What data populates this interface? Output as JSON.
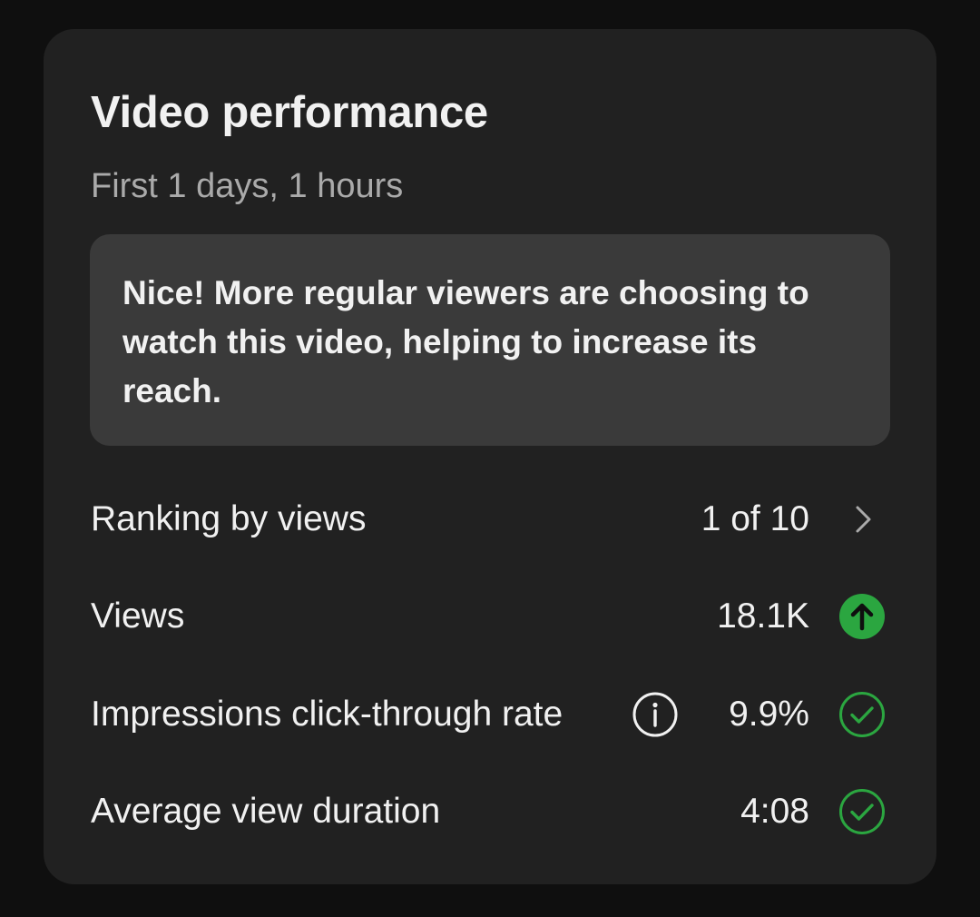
{
  "card": {
    "title": "Video performance",
    "subtitle": "First 1 days, 1 hours",
    "insight": "Nice! More regular viewers are choosing to watch this video, helping to increase its reach."
  },
  "metrics": [
    {
      "label": "Ranking by views",
      "value": "1 of 10",
      "icon": "chevron-right-icon"
    },
    {
      "label": "Views",
      "value": "18.1K",
      "icon": "arrow-up-circle-icon"
    },
    {
      "label": "Impressions click-through rate",
      "value": "9.9%",
      "icon": "check-circle-icon",
      "info_icon": "info-icon"
    },
    {
      "label": "Average view duration",
      "value": "4:08",
      "icon": "check-circle-icon"
    }
  ],
  "colors": {
    "page_background": "#0f0f0f",
    "card_background": "#212121",
    "insight_background": "#3a3a3a",
    "primary_text": "#f1f1f1",
    "secondary_text": "#aaaaaa",
    "positive_green": "#2ba640"
  }
}
